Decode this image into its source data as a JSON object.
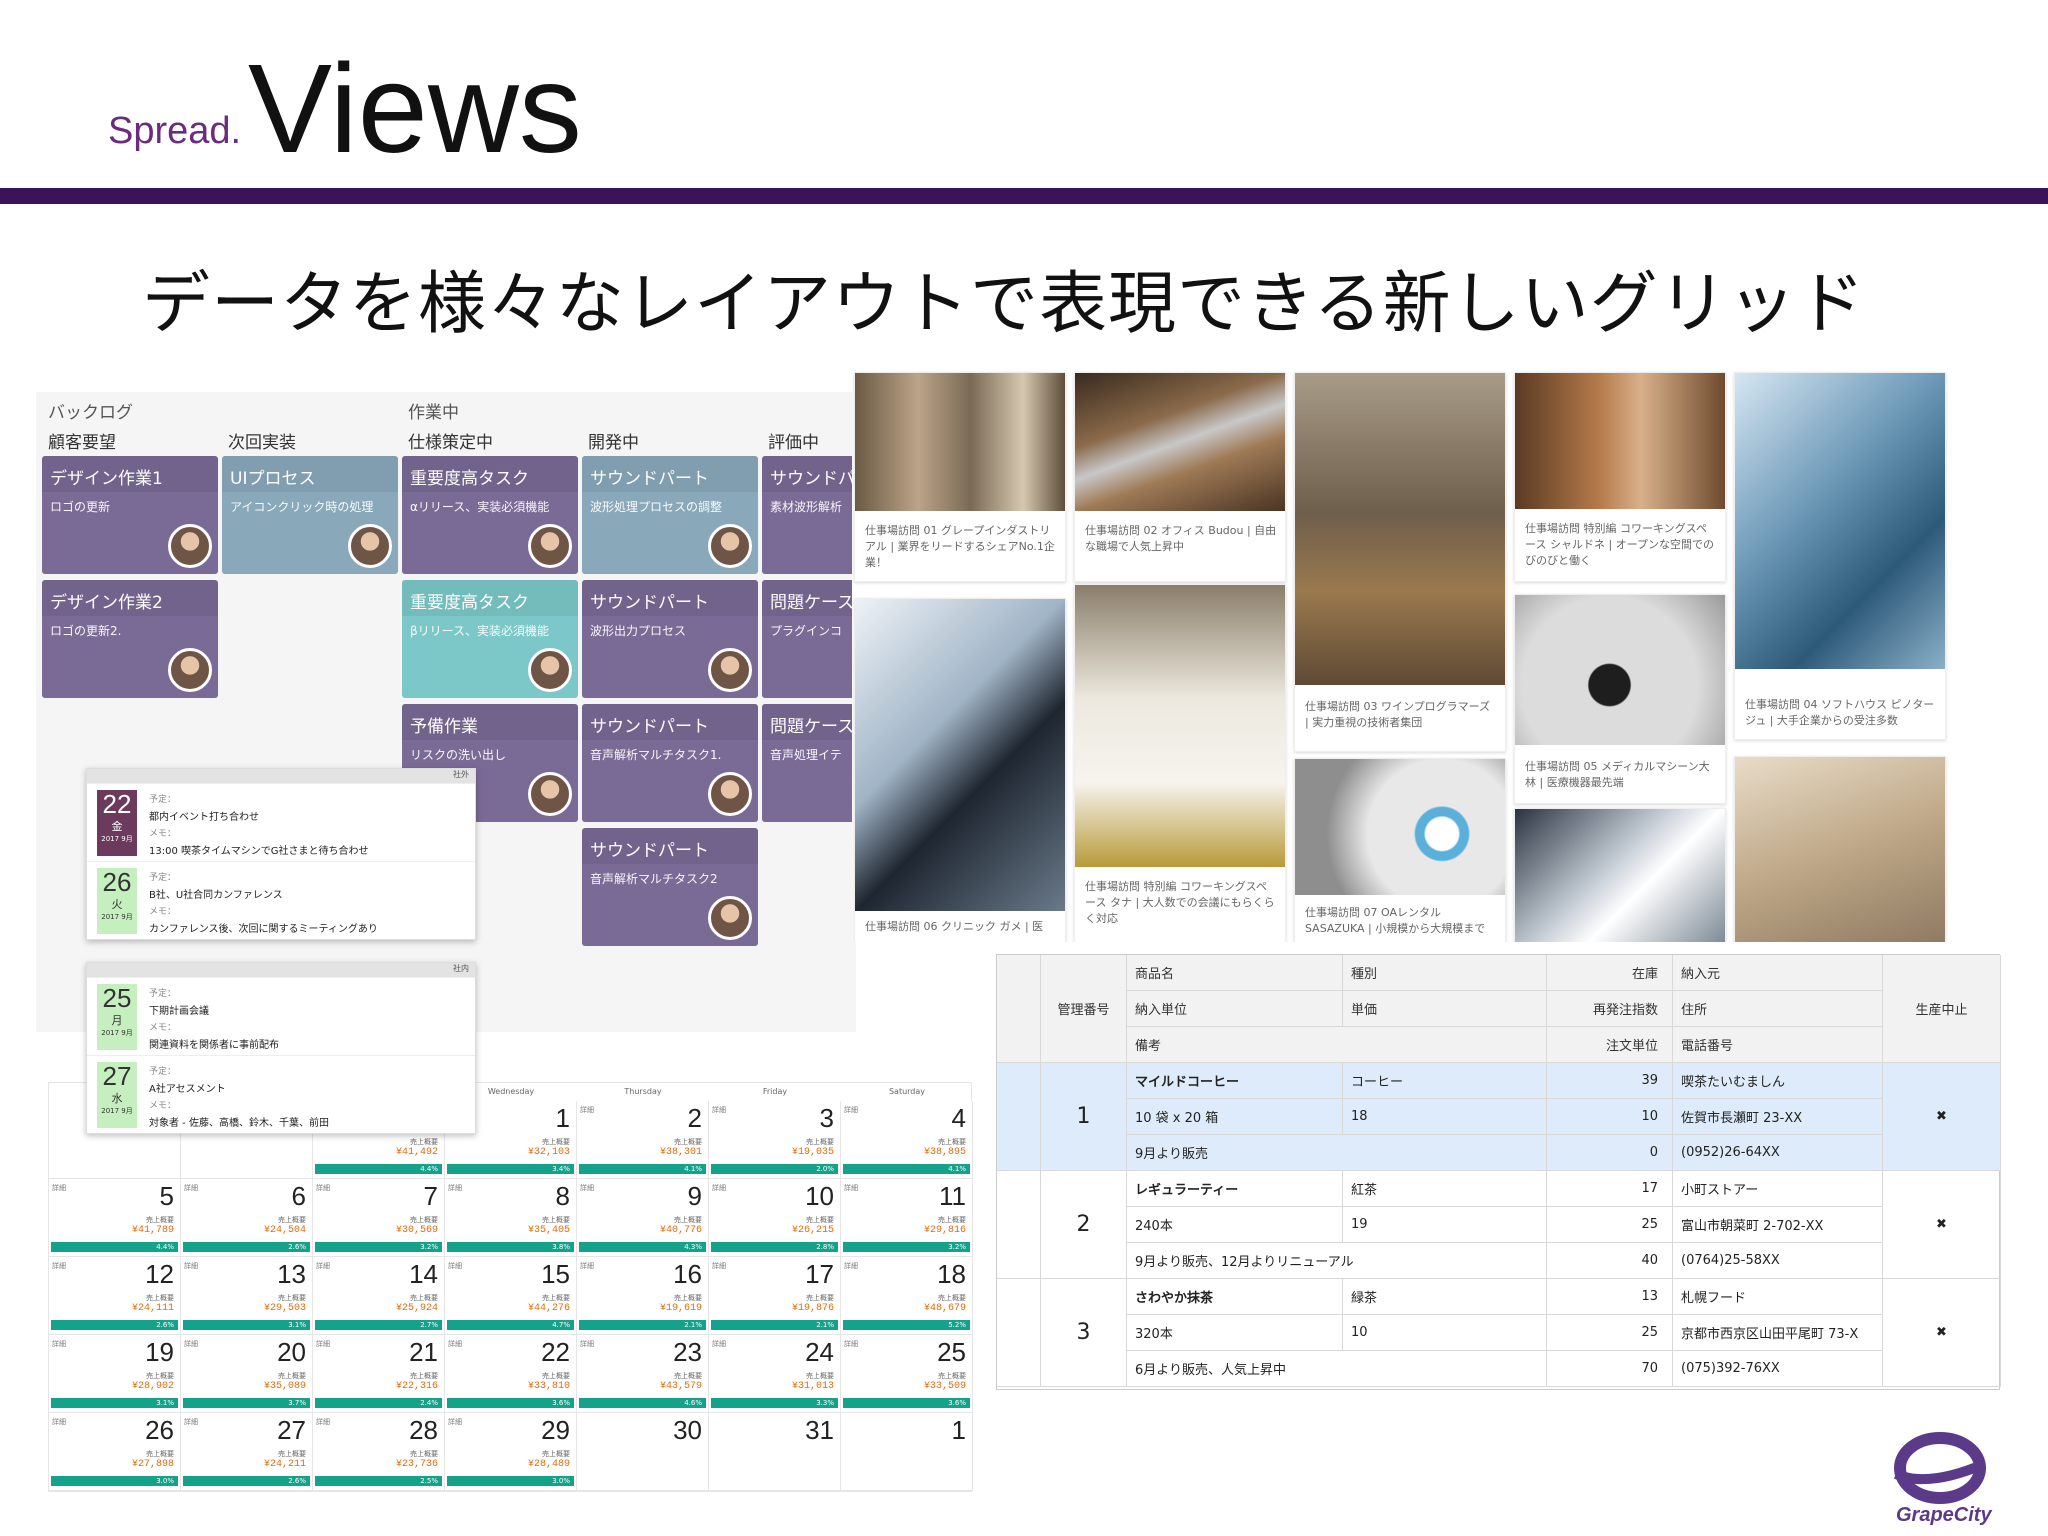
{
  "header": {
    "brand_small": "Spread.",
    "brand_large": "Views",
    "subtitle": "データを様々なレイアウトで表現できる新しいグリッド"
  },
  "colors": {
    "rule": "#3b1458",
    "brand": "#6b2c7e",
    "card_purple": "#7a6a96",
    "card_teal": "#7cc8c8",
    "card_greyteal": "#89a8ba",
    "calendar_bar": "#14a38a",
    "calendar_amount": "#e36b0a",
    "grid_selected": "#ddebfb"
  },
  "kanban": {
    "groups": [
      "バックログ",
      "作業中"
    ],
    "columns": [
      "顧客要望",
      "次回実装",
      "仕様策定中",
      "開発中",
      "評価中"
    ],
    "cards": [
      {
        "title": "デザイン作業1",
        "body": "ロゴの更新",
        "color": "purple"
      },
      {
        "title": "デザイン作業2",
        "body": "ロゴの更新2.",
        "color": "purple"
      },
      {
        "title": "UIプロセス",
        "body": "アイコンクリック時の処理",
        "color": "greyteal"
      },
      {
        "title": "重要度高タスク",
        "body": "αリリース、実装必須機能",
        "color": "purple"
      },
      {
        "title": "重要度高タスク",
        "body": "βリリース、実装必須機能",
        "color": "teal"
      },
      {
        "title": "予備作業",
        "body": "リスクの洗い出し",
        "color": "purple"
      },
      {
        "title": "サウンドパート",
        "body": "波形処理プロセスの調整",
        "color": "greyteal"
      },
      {
        "title": "サウンドパート",
        "body": "波形出力プロセス",
        "color": "purple"
      },
      {
        "title": "サウンドパート",
        "body": "音声解析マルチタスク1.",
        "color": "purple"
      },
      {
        "title": "サウンドパート",
        "body": "音声解析マルチタスク2",
        "color": "purple"
      },
      {
        "title": "サウンドパ",
        "body": "素材波形解析",
        "color": "purple"
      },
      {
        "title": "問題ケース",
        "body": "プラグインコ",
        "color": "purple"
      },
      {
        "title": "問題ケース",
        "body": "音声処理イテ",
        "color": "purple"
      }
    ]
  },
  "schedule": {
    "group1_tag": "社外",
    "group2_tag": "社内",
    "labels": {
      "plan": "予定：",
      "memo": "メモ："
    },
    "items": [
      {
        "day": "22",
        "dow": "金",
        "ym": "2017 9月",
        "plan": "都内イベント打ち合わせ",
        "memo": "13:00 喫茶タイムマシンでG社さまと待ち合わせ"
      },
      {
        "day": "26",
        "dow": "火",
        "ym": "2017 9月",
        "plan": "B社、U社合同カンファレンス",
        "memo": "カンファレンス後、次回に関するミーティングあり"
      },
      {
        "day": "25",
        "dow": "月",
        "ym": "2017 9月",
        "plan": "下期計画会議",
        "memo": "関連資料を関係者に事前配布"
      },
      {
        "day": "27",
        "dow": "水",
        "ym": "2017 9月",
        "plan": "A社アセスメント",
        "memo": "対象者 - 佐藤、高橋、鈴木、千葉、前田"
      }
    ]
  },
  "calendar": {
    "weekdays": [
      "Wednesday",
      "Thursday",
      "Friday",
      "Saturday"
    ],
    "detail_tag": "詳細",
    "sales_label": "売上概要",
    "cells": [
      {
        "day": "",
        "amount": "",
        "pct": ""
      },
      {
        "day": "",
        "amount": "",
        "pct": ""
      },
      {
        "day": "",
        "amount": "¥41,492",
        "pct": "4.4%"
      },
      {
        "day": "1",
        "amount": "¥32,103",
        "pct": "3.4%"
      },
      {
        "day": "2",
        "amount": "¥38,301",
        "pct": "4.1%"
      },
      {
        "day": "3",
        "amount": "¥19,035",
        "pct": "2.0%"
      },
      {
        "day": "4",
        "amount": "¥38,895",
        "pct": "4.1%"
      },
      {
        "day": "5",
        "amount": "¥41,789",
        "pct": "4.4%"
      },
      {
        "day": "6",
        "amount": "¥24,504",
        "pct": "2.6%"
      },
      {
        "day": "7",
        "amount": "¥30,569",
        "pct": "3.2%"
      },
      {
        "day": "8",
        "amount": "¥35,405",
        "pct": "3.8%"
      },
      {
        "day": "9",
        "amount": "¥40,776",
        "pct": "4.3%"
      },
      {
        "day": "10",
        "amount": "¥26,215",
        "pct": "2.8%"
      },
      {
        "day": "11",
        "amount": "¥29,816",
        "pct": "3.2%"
      },
      {
        "day": "12",
        "amount": "¥24,111",
        "pct": "2.6%"
      },
      {
        "day": "13",
        "amount": "¥29,503",
        "pct": "3.1%"
      },
      {
        "day": "14",
        "amount": "¥25,924",
        "pct": "2.7%"
      },
      {
        "day": "15",
        "amount": "¥44,276",
        "pct": "4.7%"
      },
      {
        "day": "16",
        "amount": "¥19,619",
        "pct": "2.1%"
      },
      {
        "day": "17",
        "amount": "¥19,876",
        "pct": "2.1%"
      },
      {
        "day": "18",
        "amount": "¥48,679",
        "pct": "5.2%"
      },
      {
        "day": "19",
        "amount": "¥28,902",
        "pct": "3.1%"
      },
      {
        "day": "20",
        "amount": "¥35,089",
        "pct": "3.7%"
      },
      {
        "day": "21",
        "amount": "¥22,316",
        "pct": "2.4%"
      },
      {
        "day": "22",
        "amount": "¥33,810",
        "pct": "3.6%"
      },
      {
        "day": "23",
        "amount": "¥43,579",
        "pct": "4.6%"
      },
      {
        "day": "24",
        "amount": "¥31,013",
        "pct": "3.3%"
      },
      {
        "day": "25",
        "amount": "¥33,509",
        "pct": "3.6%"
      },
      {
        "day": "26",
        "amount": "¥27,898",
        "pct": "3.0%"
      },
      {
        "day": "27",
        "amount": "¥24,211",
        "pct": "2.6%"
      },
      {
        "day": "28",
        "amount": "¥23,736",
        "pct": "2.5%"
      },
      {
        "day": "29",
        "amount": "¥28,489",
        "pct": "3.0%"
      },
      {
        "day": "30",
        "amount": "",
        "pct": ""
      },
      {
        "day": "31",
        "amount": "",
        "pct": ""
      },
      {
        "day": "1",
        "amount": "",
        "pct": ""
      }
    ]
  },
  "photos": {
    "items": [
      {
        "caption": "仕事場訪問 01 グレープインダストリアル | 業界をリードするシェアNo.1企業！"
      },
      {
        "caption": "仕事場訪問 02 オフィス Budou | 自由な職場で人気上昇中"
      },
      {
        "caption": "仕事場訪問 03 ワインプログラマーズ | 実力重視の技術者集団"
      },
      {
        "caption": "仕事場訪問 特別編 コワーキングスペース シャルドネ | オープンな空間でのびのびと働く"
      },
      {
        "caption": "仕事場訪問 04 ソフトハウス ピノタージュ | 大手企業からの受注多数"
      },
      {
        "caption": "仕事場訪問 06 クリニック ガメ | 医"
      },
      {
        "caption": "仕事場訪問 特別編 コワーキングスペース タナ | 大人数での会議にもらくらく対応"
      },
      {
        "caption": "仕事場訪問 07 OAレンタル SASAZUKA | 小規模から大規模まで"
      },
      {
        "caption": "仕事場訪問 05 メディカルマシーン大林 | 医療機器最先端"
      },
      {
        "caption": ""
      }
    ]
  },
  "grid": {
    "headers": {
      "id": "管理番号",
      "name": "商品名",
      "unit": "納入単位",
      "note": "備考",
      "kind": "種別",
      "price": "単価",
      "stock": "在庫",
      "reorder": "再発注指数",
      "order_unit": "注文単位",
      "vendor": "納入元",
      "address": "住所",
      "phone": "電話番号",
      "discontinued": "生産中止"
    },
    "rows": [
      {
        "id": "1",
        "name": "マイルドコーヒー",
        "unit": "10 袋 x 20 箱",
        "note": "9月より販売",
        "kind": "コーヒー",
        "price": "18",
        "stock": "39",
        "reorder": "10",
        "order_unit": "0",
        "vendor": "喫茶たいむましん",
        "address": "佐賀市長瀬町 23-XX",
        "phone": "(0952)26-64XX",
        "discontinued": "✖"
      },
      {
        "id": "2",
        "name": "レギュラーティー",
        "unit": "240本",
        "note": "9月より販売、12月よりリニューアル",
        "kind": "紅茶",
        "price": "19",
        "stock": "17",
        "reorder": "25",
        "order_unit": "40",
        "vendor": "小町ストアー",
        "address": "富山市朝菜町 2-702-XX",
        "phone": "(0764)25-58XX",
        "discontinued": "✖"
      },
      {
        "id": "3",
        "name": "さわやか抹茶",
        "unit": "320本",
        "note": "6月より販売、人気上昇中",
        "kind": "緑茶",
        "price": "10",
        "stock": "13",
        "reorder": "25",
        "order_unit": "70",
        "vendor": "札幌フード",
        "address": "京都市西京区山田平尾町 73-X",
        "phone": "(075)392-76XX",
        "discontinued": "✖"
      }
    ]
  },
  "logo": {
    "text": "GrapeCity",
    "mark": "®"
  }
}
